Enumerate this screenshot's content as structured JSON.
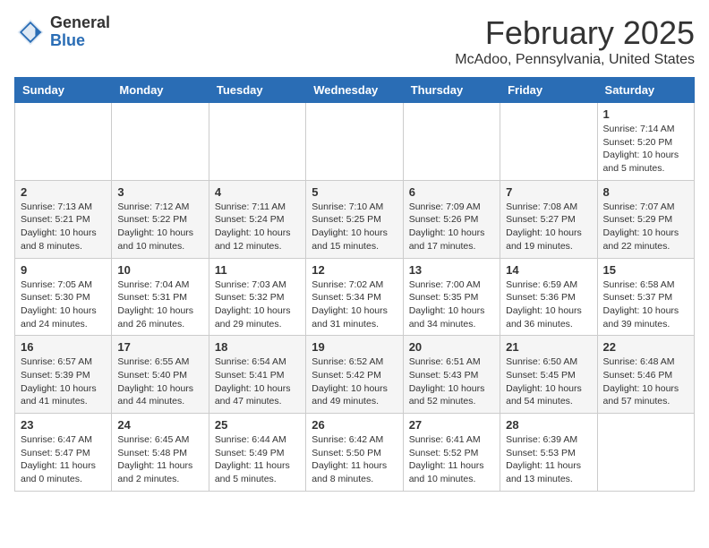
{
  "header": {
    "logo_general": "General",
    "logo_blue": "Blue",
    "month_title": "February 2025",
    "location": "McAdoo, Pennsylvania, United States"
  },
  "weekdays": [
    "Sunday",
    "Monday",
    "Tuesday",
    "Wednesday",
    "Thursday",
    "Friday",
    "Saturday"
  ],
  "weeks": [
    [
      {
        "day": "",
        "info": ""
      },
      {
        "day": "",
        "info": ""
      },
      {
        "day": "",
        "info": ""
      },
      {
        "day": "",
        "info": ""
      },
      {
        "day": "",
        "info": ""
      },
      {
        "day": "",
        "info": ""
      },
      {
        "day": "1",
        "info": "Sunrise: 7:14 AM\nSunset: 5:20 PM\nDaylight: 10 hours and 5 minutes."
      }
    ],
    [
      {
        "day": "2",
        "info": "Sunrise: 7:13 AM\nSunset: 5:21 PM\nDaylight: 10 hours and 8 minutes."
      },
      {
        "day": "3",
        "info": "Sunrise: 7:12 AM\nSunset: 5:22 PM\nDaylight: 10 hours and 10 minutes."
      },
      {
        "day": "4",
        "info": "Sunrise: 7:11 AM\nSunset: 5:24 PM\nDaylight: 10 hours and 12 minutes."
      },
      {
        "day": "5",
        "info": "Sunrise: 7:10 AM\nSunset: 5:25 PM\nDaylight: 10 hours and 15 minutes."
      },
      {
        "day": "6",
        "info": "Sunrise: 7:09 AM\nSunset: 5:26 PM\nDaylight: 10 hours and 17 minutes."
      },
      {
        "day": "7",
        "info": "Sunrise: 7:08 AM\nSunset: 5:27 PM\nDaylight: 10 hours and 19 minutes."
      },
      {
        "day": "8",
        "info": "Sunrise: 7:07 AM\nSunset: 5:29 PM\nDaylight: 10 hours and 22 minutes."
      }
    ],
    [
      {
        "day": "9",
        "info": "Sunrise: 7:05 AM\nSunset: 5:30 PM\nDaylight: 10 hours and 24 minutes."
      },
      {
        "day": "10",
        "info": "Sunrise: 7:04 AM\nSunset: 5:31 PM\nDaylight: 10 hours and 26 minutes."
      },
      {
        "day": "11",
        "info": "Sunrise: 7:03 AM\nSunset: 5:32 PM\nDaylight: 10 hours and 29 minutes."
      },
      {
        "day": "12",
        "info": "Sunrise: 7:02 AM\nSunset: 5:34 PM\nDaylight: 10 hours and 31 minutes."
      },
      {
        "day": "13",
        "info": "Sunrise: 7:00 AM\nSunset: 5:35 PM\nDaylight: 10 hours and 34 minutes."
      },
      {
        "day": "14",
        "info": "Sunrise: 6:59 AM\nSunset: 5:36 PM\nDaylight: 10 hours and 36 minutes."
      },
      {
        "day": "15",
        "info": "Sunrise: 6:58 AM\nSunset: 5:37 PM\nDaylight: 10 hours and 39 minutes."
      }
    ],
    [
      {
        "day": "16",
        "info": "Sunrise: 6:57 AM\nSunset: 5:39 PM\nDaylight: 10 hours and 41 minutes."
      },
      {
        "day": "17",
        "info": "Sunrise: 6:55 AM\nSunset: 5:40 PM\nDaylight: 10 hours and 44 minutes."
      },
      {
        "day": "18",
        "info": "Sunrise: 6:54 AM\nSunset: 5:41 PM\nDaylight: 10 hours and 47 minutes."
      },
      {
        "day": "19",
        "info": "Sunrise: 6:52 AM\nSunset: 5:42 PM\nDaylight: 10 hours and 49 minutes."
      },
      {
        "day": "20",
        "info": "Sunrise: 6:51 AM\nSunset: 5:43 PM\nDaylight: 10 hours and 52 minutes."
      },
      {
        "day": "21",
        "info": "Sunrise: 6:50 AM\nSunset: 5:45 PM\nDaylight: 10 hours and 54 minutes."
      },
      {
        "day": "22",
        "info": "Sunrise: 6:48 AM\nSunset: 5:46 PM\nDaylight: 10 hours and 57 minutes."
      }
    ],
    [
      {
        "day": "23",
        "info": "Sunrise: 6:47 AM\nSunset: 5:47 PM\nDaylight: 11 hours and 0 minutes."
      },
      {
        "day": "24",
        "info": "Sunrise: 6:45 AM\nSunset: 5:48 PM\nDaylight: 11 hours and 2 minutes."
      },
      {
        "day": "25",
        "info": "Sunrise: 6:44 AM\nSunset: 5:49 PM\nDaylight: 11 hours and 5 minutes."
      },
      {
        "day": "26",
        "info": "Sunrise: 6:42 AM\nSunset: 5:50 PM\nDaylight: 11 hours and 8 minutes."
      },
      {
        "day": "27",
        "info": "Sunrise: 6:41 AM\nSunset: 5:52 PM\nDaylight: 11 hours and 10 minutes."
      },
      {
        "day": "28",
        "info": "Sunrise: 6:39 AM\nSunset: 5:53 PM\nDaylight: 11 hours and 13 minutes."
      },
      {
        "day": "",
        "info": ""
      }
    ]
  ]
}
